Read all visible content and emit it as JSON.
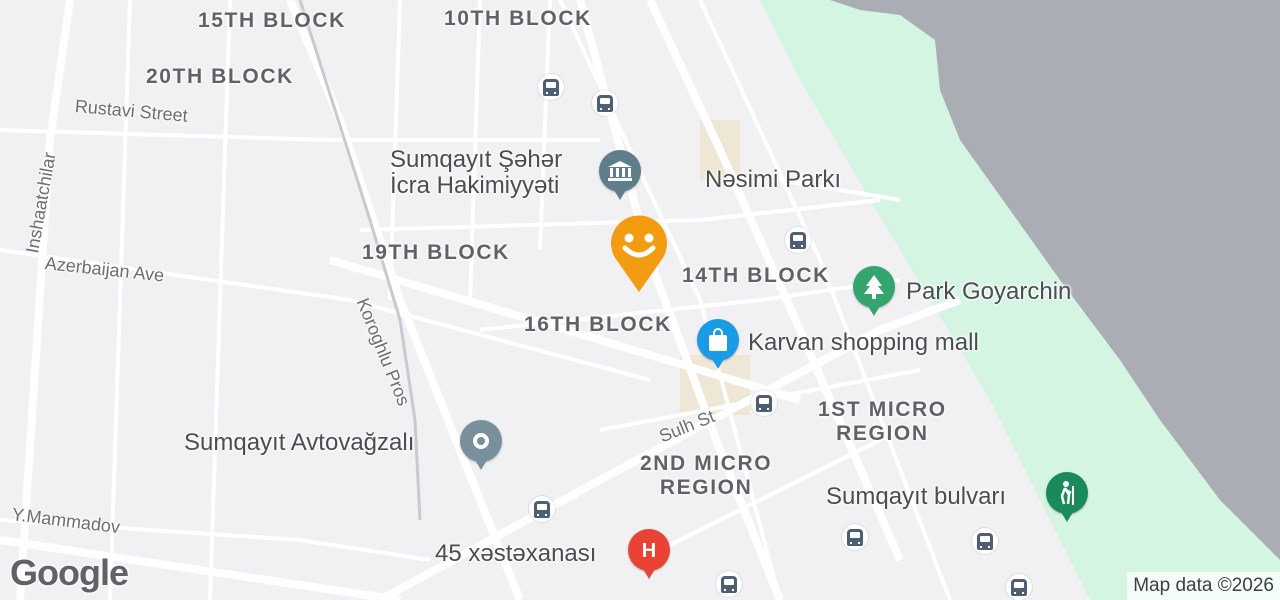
{
  "map": {
    "areas": {
      "block15": "15TH BLOCK",
      "block10": "10TH BLOCK",
      "block20": "20TH BLOCK",
      "block19": "19TH BLOCK",
      "block14": "14TH BLOCK",
      "block16": "16TH BLOCK",
      "micro1": [
        "1ST MICRO",
        "REGION"
      ],
      "micro2": [
        "2ND MICRO",
        "REGION"
      ]
    },
    "streets": {
      "rustavi": "Rustavi Street",
      "inshaatchilar": "Inshaatchilar",
      "azerbaijan": "Azerbaijan Ave",
      "koroghlu": "Koroghlu Pros",
      "sulh": "Sulh St",
      "mammadov": "Y.Mammadov"
    },
    "places": {
      "city_hall": [
        "Sumqayıt Şəhər",
        "İcra Hakimiyyəti"
      ],
      "nesimi_park": "Nəsimi Parkı",
      "park_goyarchin": "Park Goyarchin",
      "karvan_mall": "Karvan shopping mall",
      "bus_station": "Sumqayıt Avtovağzalı",
      "bulvari": "Sumqayıt bulvarı",
      "hospital": "45 xəstəxanası"
    },
    "icons": {
      "city_hall": "landmark-icon",
      "park": "tree-icon",
      "mall": "shopping-bag-icon",
      "bus_station": "transit-station-icon",
      "bulvari": "hiking-icon",
      "hospital": "hospital-icon",
      "featured": "smiley-icon",
      "bus_stop": "bus-icon"
    },
    "colors": {
      "land": "#f1f1f3",
      "water": "#aaadb3",
      "green": "#d5f5e3",
      "road": "#ffffff",
      "commercial": "#efe7d5",
      "landmark_pin": "#607d8b",
      "park_pin": "#34a56f",
      "mall_pin": "#1a9be6",
      "hospital_pin": "#ea4335",
      "featured_pin": "#f39c12"
    }
  },
  "branding": {
    "logo": "Google",
    "attribution": "Map data ©2026"
  }
}
